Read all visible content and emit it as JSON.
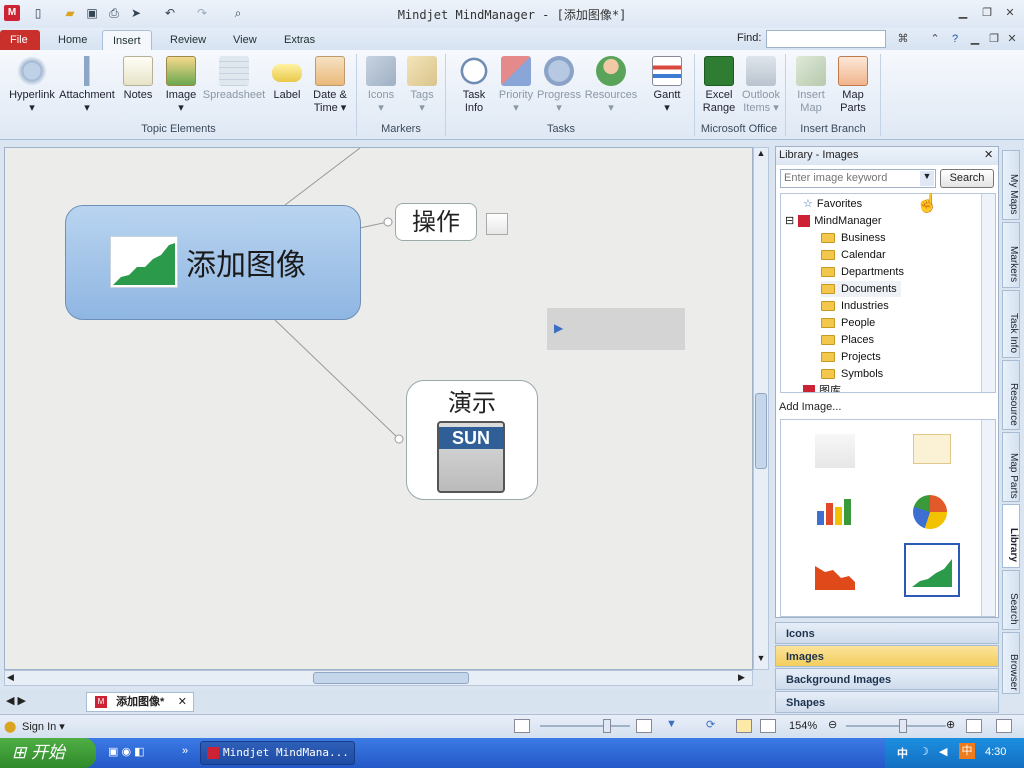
{
  "window": {
    "title": "Mindjet MindManager - [添加图像*]"
  },
  "tabs": [
    {
      "label": "File"
    },
    {
      "label": "Home"
    },
    {
      "label": "Insert"
    },
    {
      "label": "Review"
    },
    {
      "label": "View"
    },
    {
      "label": "Extras"
    }
  ],
  "find": {
    "label": "Find:",
    "value": ""
  },
  "ribbon": {
    "buttons": [
      {
        "label": "Hyperlink",
        "icon": "hyperlink-icon"
      },
      {
        "label": "Attachment",
        "icon": "paperclip-icon"
      },
      {
        "label": "Notes",
        "icon": "notes-icon"
      },
      {
        "label": "Image",
        "icon": "image-icon"
      },
      {
        "label": "Spreadsheet",
        "icon": "spreadsheet-icon"
      },
      {
        "label": "Label",
        "icon": "label-icon"
      },
      {
        "label": "Date &",
        "label2": "Time",
        "icon": "calendar-icon"
      },
      {
        "label": "Icons",
        "icon": "icons-icon"
      },
      {
        "label": "Tags",
        "icon": "tags-icon"
      },
      {
        "label": "Task",
        "label2": "Info",
        "icon": "task-info-icon"
      },
      {
        "label": "Priority",
        "icon": "priority-icon"
      },
      {
        "label": "Progress",
        "icon": "progress-icon"
      },
      {
        "label": "Resources",
        "icon": "resources-icon"
      },
      {
        "label": "Gantt",
        "icon": "gantt-icon"
      },
      {
        "label": "Excel",
        "label2": "Range",
        "icon": "excel-icon"
      },
      {
        "label": "Outlook",
        "label2": "Items",
        "icon": "outlook-icon"
      },
      {
        "label": "Insert",
        "label2": "Map",
        "icon": "insert-map-icon"
      },
      {
        "label": "Map",
        "label2": "Parts",
        "icon": "map-parts-icon"
      }
    ],
    "groups": [
      {
        "label": "Topic Elements"
      },
      {
        "label": "Markers"
      },
      {
        "label": "Tasks"
      },
      {
        "label": "Microsoft Office"
      },
      {
        "label": "Insert Branch"
      }
    ]
  },
  "map": {
    "central_topic": "添加图像",
    "subtopic1": "操作",
    "subtopic2": "演示",
    "sun_label": "SUN"
  },
  "library": {
    "title": "Library - Images",
    "search_placeholder": "Enter image keyword",
    "search_button": "Search",
    "tree": [
      {
        "label": "Favorites"
      },
      {
        "label": "MindManager"
      },
      {
        "label": "Business"
      },
      {
        "label": "Calendar"
      },
      {
        "label": "Departments"
      },
      {
        "label": "Documents"
      },
      {
        "label": "Industries"
      },
      {
        "label": "People"
      },
      {
        "label": "Places"
      },
      {
        "label": "Projects"
      },
      {
        "label": "Symbols"
      },
      {
        "label": "图库"
      }
    ],
    "add_image": "Add Image..."
  },
  "categories": [
    {
      "label": "Icons"
    },
    {
      "label": "Images"
    },
    {
      "label": "Background Images"
    },
    {
      "label": "Shapes"
    }
  ],
  "side_tabs": [
    {
      "label": "My Maps"
    },
    {
      "label": "Markers"
    },
    {
      "label": "Task Info"
    },
    {
      "label": "Resource"
    },
    {
      "label": "Map Parts"
    },
    {
      "label": "Library"
    },
    {
      "label": "Search"
    },
    {
      "label": "Browser"
    }
  ],
  "doc_tab": {
    "label": "添加图像*"
  },
  "status": {
    "sign_in": "Sign In",
    "zoom": "154%"
  },
  "taskbar": {
    "start": "开始",
    "app": "Mindjet MindMana...",
    "ime": "中",
    "clock": "4:30"
  }
}
